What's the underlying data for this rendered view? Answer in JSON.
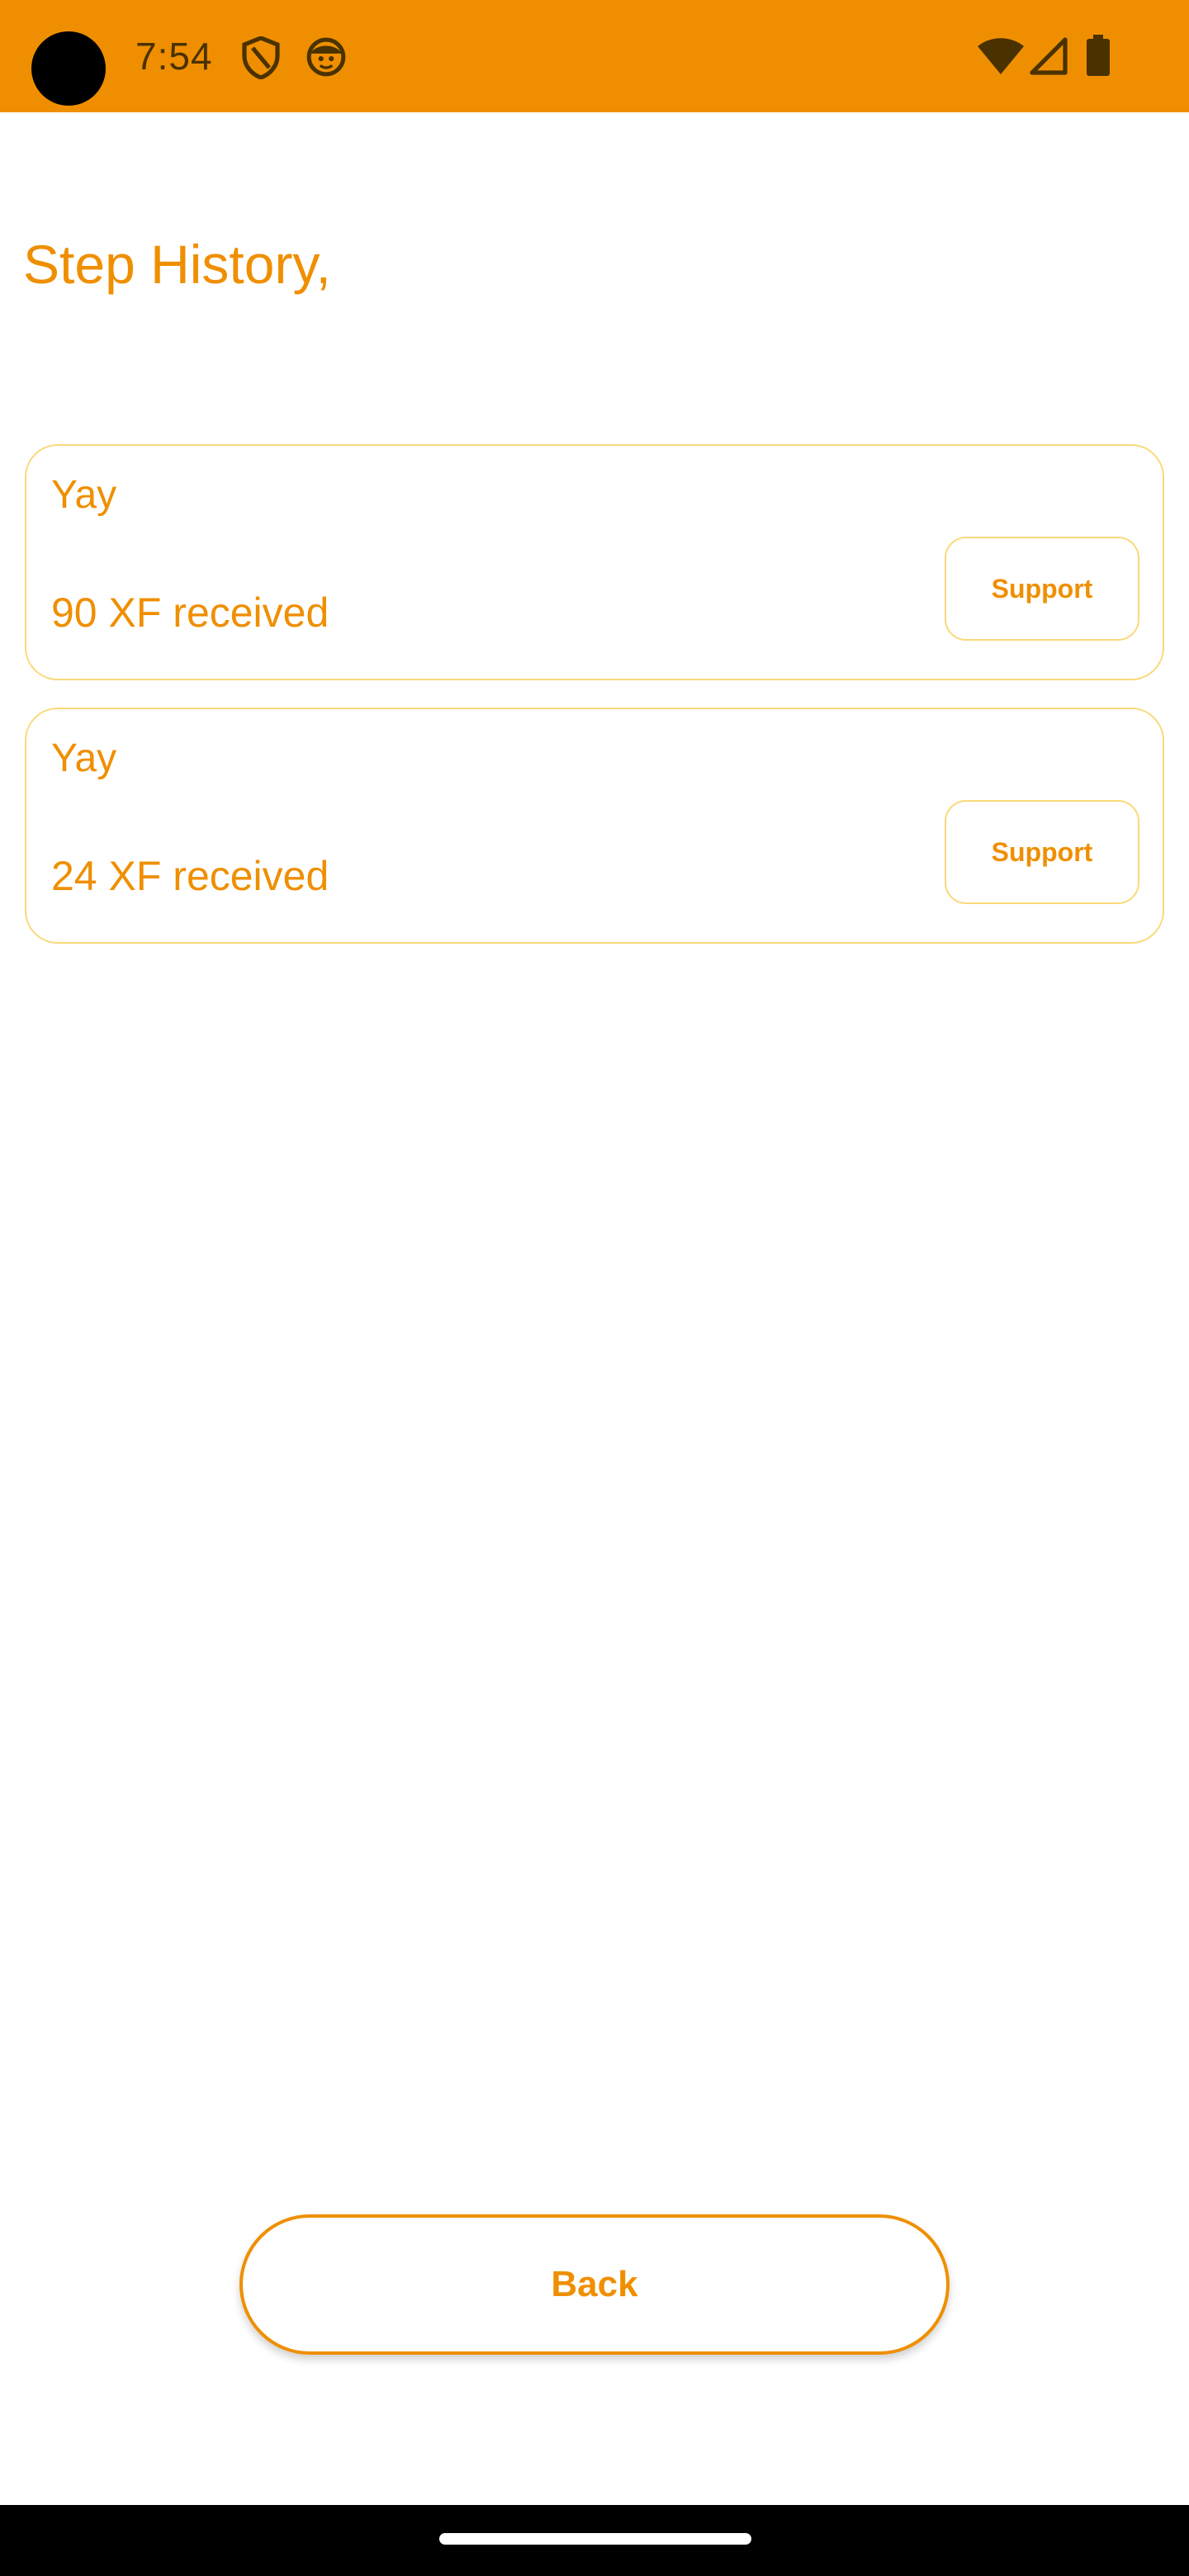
{
  "status_bar": {
    "time": "7:54",
    "icons": [
      "shield-icon",
      "face-icon",
      "wifi-icon",
      "signal-icon",
      "battery-icon"
    ],
    "background_color": "#EF8F00"
  },
  "page": {
    "title": "Step History,"
  },
  "history": [
    {
      "heading": "Yay",
      "amount": "90 XF received",
      "action_label": "Support"
    },
    {
      "heading": "Yay",
      "amount": "24 XF received",
      "action_label": "Support"
    }
  ],
  "footer": {
    "back_label": "Back"
  },
  "colors": {
    "accent": "#EF8F00",
    "card_border": "#F9D97A"
  }
}
